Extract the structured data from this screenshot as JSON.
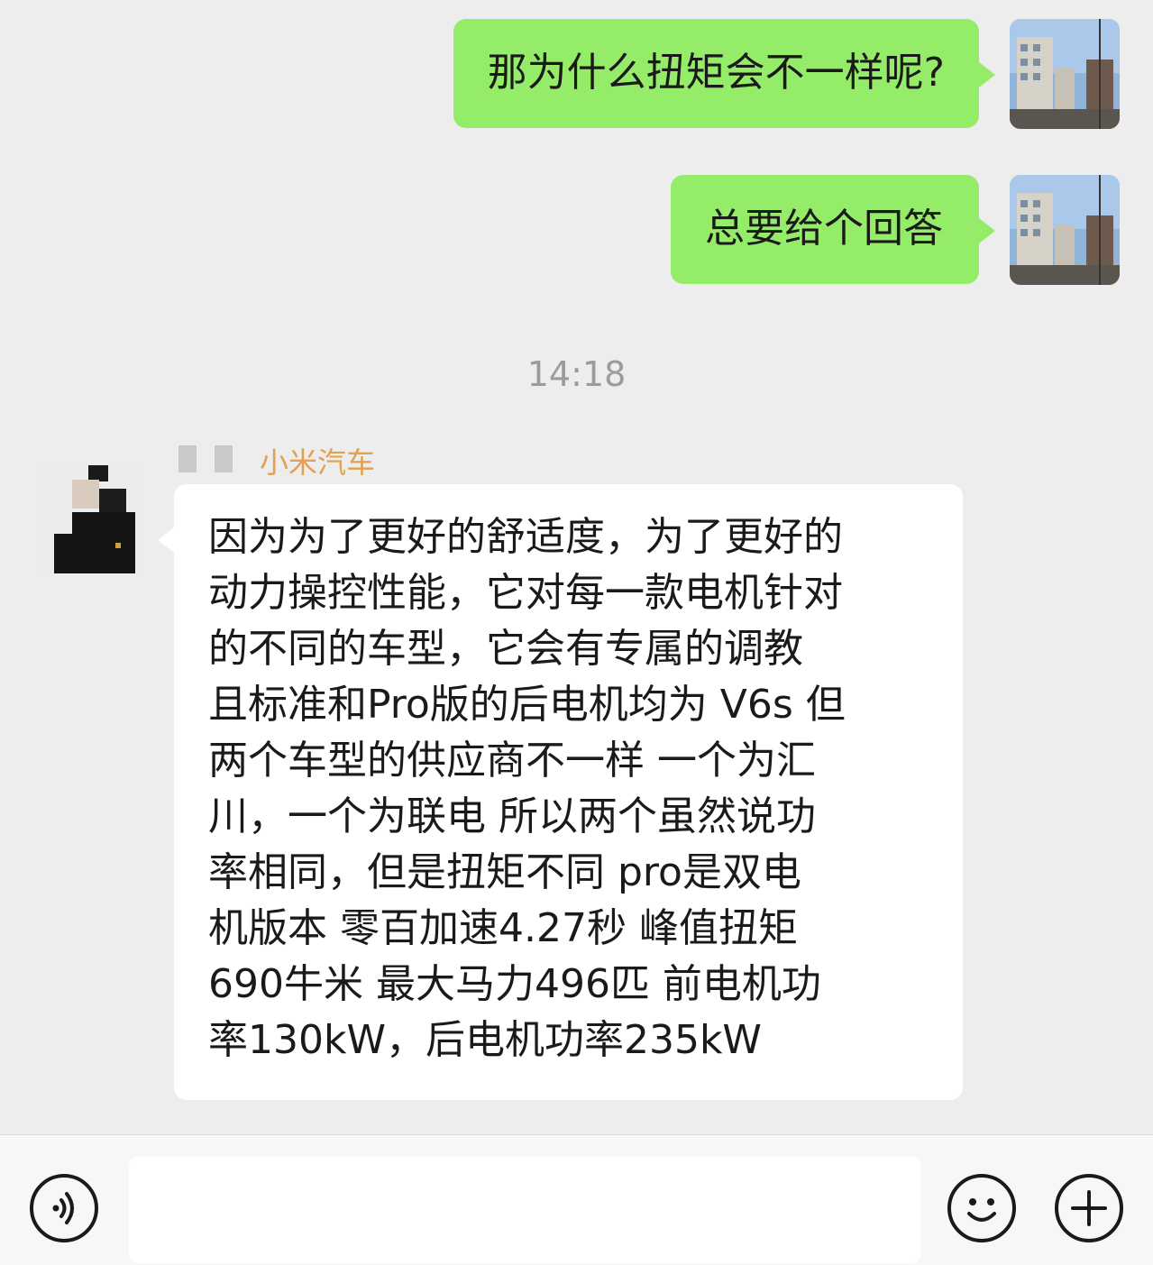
{
  "messages_out": [
    {
      "text": "那为什么扭矩会不一样呢?"
    },
    {
      "text": "总要给个回答"
    }
  ],
  "timestamp": "14:18",
  "incoming": {
    "sender_name": "小米汽车",
    "lines": [
      "因为为了更好的舒适度，为了更好的",
      "动力操控性能，它对每一款电机针对",
      "的不同的车型，它会有专属的调教",
      "且标准和Pro版的后电机均为 V6s 但",
      "两个车型的供应商不一样 一个为汇",
      "川，一个为联电   所以两个虽然说功",
      "率相同，但是扭矩不同   pro是双电",
      "机版本   零百加速4.27秒 峰值扭矩",
      "690牛米 最大马力496匹  前电机功",
      "率130kW，后电机功率235kW"
    ]
  },
  "input_bar": {
    "voice_icon": "voice-icon",
    "emoji_icon": "emoji-icon",
    "plus_icon": "plus-icon"
  }
}
